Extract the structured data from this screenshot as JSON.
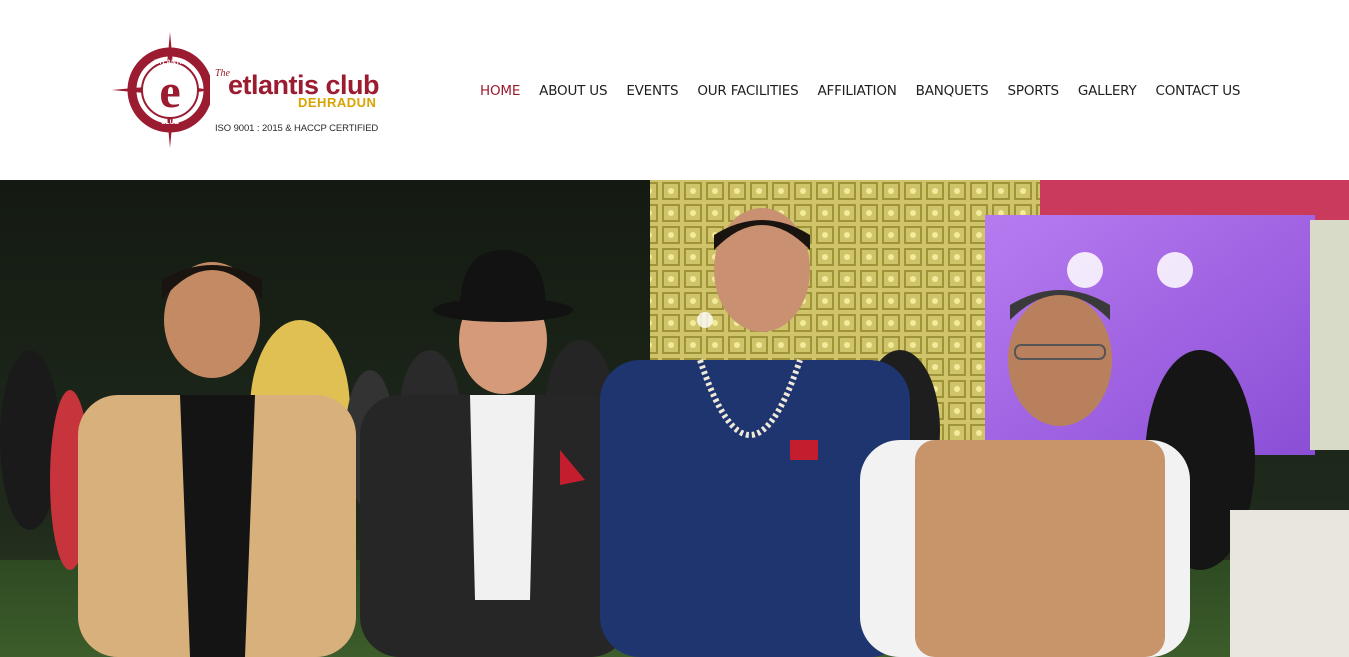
{
  "logo": {
    "the": "The",
    "name": "etlantis club",
    "city": "DEHRADUN",
    "certification": "ISO 9001 : 2015 & HACCP CERTIFIED",
    "emblem_ring_text_top": "ETLANTIS",
    "emblem_ring_text_bottom": "CLUB",
    "emblem_letter": "e"
  },
  "nav": {
    "items": [
      {
        "label": "HOME",
        "active": true
      },
      {
        "label": "ABOUT US",
        "active": false
      },
      {
        "label": "EVENTS",
        "active": false
      },
      {
        "label": "OUR FACILITIES",
        "active": false
      },
      {
        "label": "AFFILIATION",
        "active": false
      },
      {
        "label": "BANQUETS",
        "active": false
      },
      {
        "label": "SPORTS",
        "active": false
      },
      {
        "label": "GALLERY",
        "active": false
      },
      {
        "label": "CONTACT US",
        "active": false
      }
    ]
  },
  "colors": {
    "brand": "#9b1b30",
    "accent": "#d9a400",
    "nav_text": "#1f1f1f"
  },
  "hero": {
    "icon": "photo-slide"
  }
}
